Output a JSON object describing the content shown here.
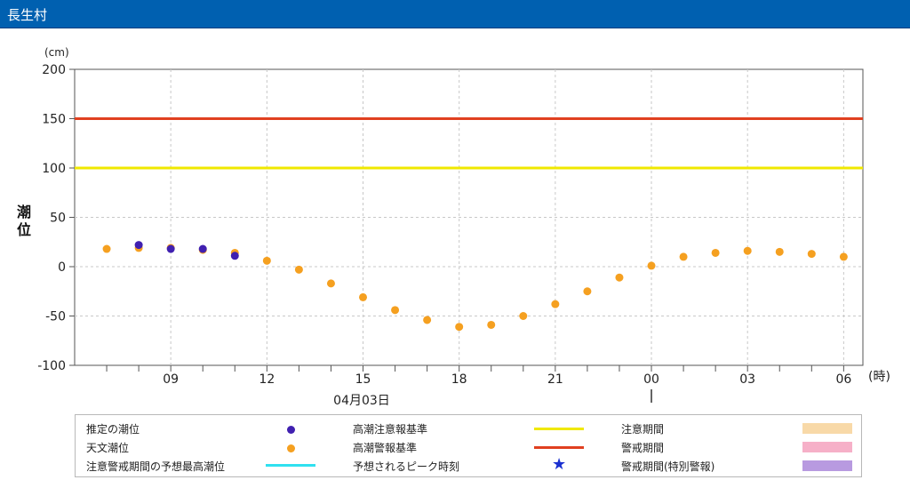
{
  "header": {
    "title": "長生村"
  },
  "chart_data": {
    "type": "scatter",
    "title": "",
    "ylabel": "潮位",
    "yunit": "(cm)",
    "xunit": "(時)",
    "date_label": "04月03日",
    "ylim": [
      -100,
      200
    ],
    "yticks": [
      -100,
      -50,
      0,
      50,
      100,
      150,
      200
    ],
    "xtick_labels": [
      "09",
      "12",
      "15",
      "18",
      "21",
      "00",
      "03",
      "06"
    ],
    "grid": true,
    "thresholds": [
      {
        "name": "高潮注意報基準",
        "value": 100,
        "color": "#f0e800"
      },
      {
        "name": "高潮警報基準",
        "value": 150,
        "color": "#e04020"
      }
    ],
    "series": [
      {
        "name": "天文潮位",
        "color": "#f5a020",
        "hours": [
          7,
          8,
          9,
          10,
          11,
          12,
          13,
          14,
          15,
          16,
          17,
          18,
          19,
          20,
          21,
          22,
          23,
          24,
          25,
          26,
          27,
          28,
          29,
          30
        ],
        "values": [
          18,
          19,
          19,
          17,
          14,
          6,
          -3,
          -17,
          -31,
          -44,
          -54,
          -61,
          -59,
          -50,
          -38,
          -25,
          -11,
          1,
          10,
          14,
          16,
          15,
          13,
          10
        ]
      },
      {
        "name": "推定の潮位",
        "color": "#4020b0",
        "hours": [
          8,
          9,
          10,
          11
        ],
        "values": [
          22,
          18,
          18,
          11
        ]
      }
    ]
  },
  "legend": {
    "estimated": "推定の潮位",
    "astronomical": "天文潮位",
    "forecast_max": "注意警戒期間の予想最高潮位",
    "advisory_std": "高潮注意報基準",
    "warning_std": "高潮警報基準",
    "peak_time": "予想されるピーク時刻",
    "advisory_period": "注意期間",
    "warning_period": "警戒期間",
    "special_period": "警戒期間(特別警報)",
    "colors": {
      "estimated": "#4020b0",
      "astronomical": "#f5a020",
      "forecast_max": "#30e0f0",
      "advisory_std": "#f0e800",
      "warning_std": "#e04020",
      "peak": "#1a30d0",
      "advisory_period": "#f8d9a8",
      "warning_period": "#f6b0c8",
      "special_period": "#b89ae0"
    }
  }
}
